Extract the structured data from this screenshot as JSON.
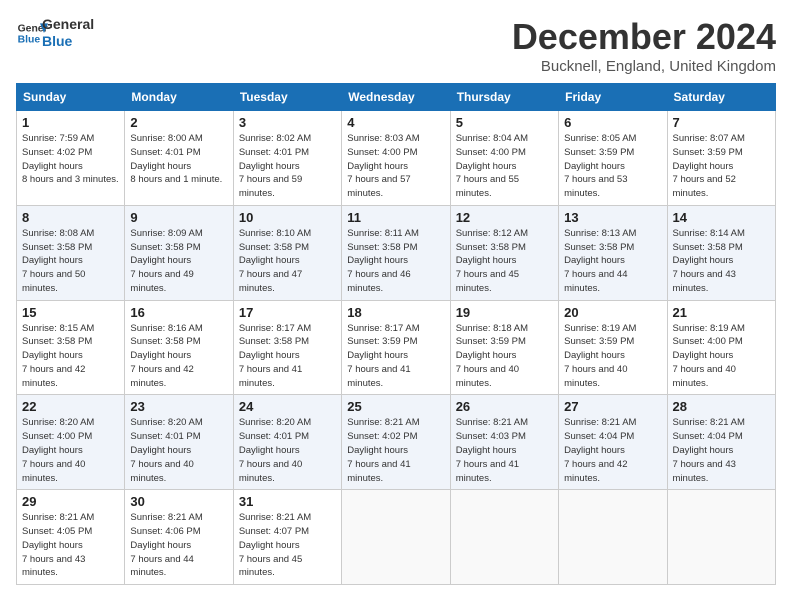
{
  "logo": {
    "line1": "General",
    "line2": "Blue"
  },
  "title": "December 2024",
  "location": "Bucknell, England, United Kingdom",
  "weekdays": [
    "Sunday",
    "Monday",
    "Tuesday",
    "Wednesday",
    "Thursday",
    "Friday",
    "Saturday"
  ],
  "weeks": [
    [
      {
        "day": "1",
        "sunrise": "Sunrise: 7:59 AM",
        "sunset": "Sunset: 4:02 PM",
        "daylight": "Daylight: 8 hours and 3 minutes."
      },
      {
        "day": "2",
        "sunrise": "Sunrise: 8:00 AM",
        "sunset": "Sunset: 4:01 PM",
        "daylight": "Daylight: 8 hours and 1 minute."
      },
      {
        "day": "3",
        "sunrise": "Sunrise: 8:02 AM",
        "sunset": "Sunset: 4:01 PM",
        "daylight": "Daylight: 7 hours and 59 minutes."
      },
      {
        "day": "4",
        "sunrise": "Sunrise: 8:03 AM",
        "sunset": "Sunset: 4:00 PM",
        "daylight": "Daylight: 7 hours and 57 minutes."
      },
      {
        "day": "5",
        "sunrise": "Sunrise: 8:04 AM",
        "sunset": "Sunset: 4:00 PM",
        "daylight": "Daylight: 7 hours and 55 minutes."
      },
      {
        "day": "6",
        "sunrise": "Sunrise: 8:05 AM",
        "sunset": "Sunset: 3:59 PM",
        "daylight": "Daylight: 7 hours and 53 minutes."
      },
      {
        "day": "7",
        "sunrise": "Sunrise: 8:07 AM",
        "sunset": "Sunset: 3:59 PM",
        "daylight": "Daylight: 7 hours and 52 minutes."
      }
    ],
    [
      {
        "day": "8",
        "sunrise": "Sunrise: 8:08 AM",
        "sunset": "Sunset: 3:58 PM",
        "daylight": "Daylight: 7 hours and 50 minutes."
      },
      {
        "day": "9",
        "sunrise": "Sunrise: 8:09 AM",
        "sunset": "Sunset: 3:58 PM",
        "daylight": "Daylight: 7 hours and 49 minutes."
      },
      {
        "day": "10",
        "sunrise": "Sunrise: 8:10 AM",
        "sunset": "Sunset: 3:58 PM",
        "daylight": "Daylight: 7 hours and 47 minutes."
      },
      {
        "day": "11",
        "sunrise": "Sunrise: 8:11 AM",
        "sunset": "Sunset: 3:58 PM",
        "daylight": "Daylight: 7 hours and 46 minutes."
      },
      {
        "day": "12",
        "sunrise": "Sunrise: 8:12 AM",
        "sunset": "Sunset: 3:58 PM",
        "daylight": "Daylight: 7 hours and 45 minutes."
      },
      {
        "day": "13",
        "sunrise": "Sunrise: 8:13 AM",
        "sunset": "Sunset: 3:58 PM",
        "daylight": "Daylight: 7 hours and 44 minutes."
      },
      {
        "day": "14",
        "sunrise": "Sunrise: 8:14 AM",
        "sunset": "Sunset: 3:58 PM",
        "daylight": "Daylight: 7 hours and 43 minutes."
      }
    ],
    [
      {
        "day": "15",
        "sunrise": "Sunrise: 8:15 AM",
        "sunset": "Sunset: 3:58 PM",
        "daylight": "Daylight: 7 hours and 42 minutes."
      },
      {
        "day": "16",
        "sunrise": "Sunrise: 8:16 AM",
        "sunset": "Sunset: 3:58 PM",
        "daylight": "Daylight: 7 hours and 42 minutes."
      },
      {
        "day": "17",
        "sunrise": "Sunrise: 8:17 AM",
        "sunset": "Sunset: 3:58 PM",
        "daylight": "Daylight: 7 hours and 41 minutes."
      },
      {
        "day": "18",
        "sunrise": "Sunrise: 8:17 AM",
        "sunset": "Sunset: 3:59 PM",
        "daylight": "Daylight: 7 hours and 41 minutes."
      },
      {
        "day": "19",
        "sunrise": "Sunrise: 8:18 AM",
        "sunset": "Sunset: 3:59 PM",
        "daylight": "Daylight: 7 hours and 40 minutes."
      },
      {
        "day": "20",
        "sunrise": "Sunrise: 8:19 AM",
        "sunset": "Sunset: 3:59 PM",
        "daylight": "Daylight: 7 hours and 40 minutes."
      },
      {
        "day": "21",
        "sunrise": "Sunrise: 8:19 AM",
        "sunset": "Sunset: 4:00 PM",
        "daylight": "Daylight: 7 hours and 40 minutes."
      }
    ],
    [
      {
        "day": "22",
        "sunrise": "Sunrise: 8:20 AM",
        "sunset": "Sunset: 4:00 PM",
        "daylight": "Daylight: 7 hours and 40 minutes."
      },
      {
        "day": "23",
        "sunrise": "Sunrise: 8:20 AM",
        "sunset": "Sunset: 4:01 PM",
        "daylight": "Daylight: 7 hours and 40 minutes."
      },
      {
        "day": "24",
        "sunrise": "Sunrise: 8:20 AM",
        "sunset": "Sunset: 4:01 PM",
        "daylight": "Daylight: 7 hours and 40 minutes."
      },
      {
        "day": "25",
        "sunrise": "Sunrise: 8:21 AM",
        "sunset": "Sunset: 4:02 PM",
        "daylight": "Daylight: 7 hours and 41 minutes."
      },
      {
        "day": "26",
        "sunrise": "Sunrise: 8:21 AM",
        "sunset": "Sunset: 4:03 PM",
        "daylight": "Daylight: 7 hours and 41 minutes."
      },
      {
        "day": "27",
        "sunrise": "Sunrise: 8:21 AM",
        "sunset": "Sunset: 4:04 PM",
        "daylight": "Daylight: 7 hours and 42 minutes."
      },
      {
        "day": "28",
        "sunrise": "Sunrise: 8:21 AM",
        "sunset": "Sunset: 4:04 PM",
        "daylight": "Daylight: 7 hours and 43 minutes."
      }
    ],
    [
      {
        "day": "29",
        "sunrise": "Sunrise: 8:21 AM",
        "sunset": "Sunset: 4:05 PM",
        "daylight": "Daylight: 7 hours and 43 minutes."
      },
      {
        "day": "30",
        "sunrise": "Sunrise: 8:21 AM",
        "sunset": "Sunset: 4:06 PM",
        "daylight": "Daylight: 7 hours and 44 minutes."
      },
      {
        "day": "31",
        "sunrise": "Sunrise: 8:21 AM",
        "sunset": "Sunset: 4:07 PM",
        "daylight": "Daylight: 7 hours and 45 minutes."
      },
      null,
      null,
      null,
      null
    ]
  ]
}
